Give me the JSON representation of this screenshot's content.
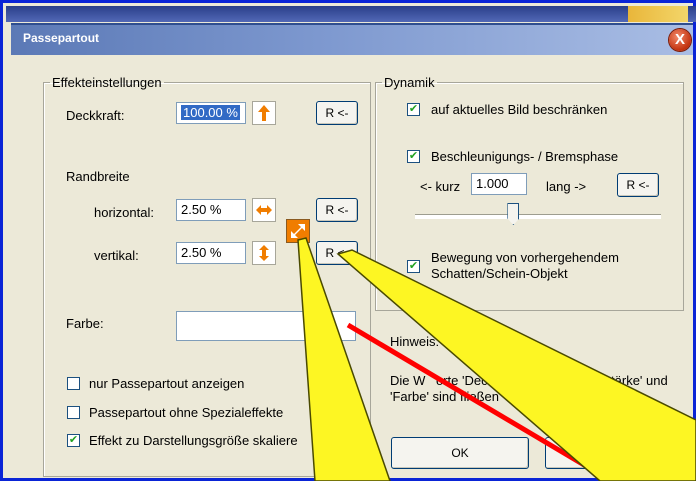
{
  "window": {
    "title": "Passepartout",
    "close_glyph": "X"
  },
  "effekt": {
    "legend": "Effekteinstellungen",
    "deckkraft_label": "Deckkraft:",
    "deckkraft_value": "100.00 %",
    "reset_label": "R <-",
    "randbreite_label": "Randbreite",
    "horizontal_label": "horizontal:",
    "horizontal_value": "2.50 %",
    "vertikal_label": "vertikal:",
    "vertikal_value": "2.50 %",
    "farbe_label": "Farbe:",
    "farbe_value": "",
    "checkboxes": [
      {
        "label": "nur Passepartout anzeigen",
        "checked": false
      },
      {
        "label": "Passepartout ohne Spezialeffekte",
        "checked": false
      },
      {
        "label": "Effekt zu Darstellungsgröße skaliere",
        "checked": true
      }
    ]
  },
  "dynamik": {
    "legend": "Dynamik",
    "cb_aktuelles": "auf aktuelles Bild beschränken",
    "cb_beschl": "Beschleunigungs- / Bremsphase",
    "kurz_label": "<- kurz",
    "kurz_value": "1.000",
    "lang_label": "lang ->",
    "reset_label": "R <-",
    "slider_level": 0.4,
    "cb_bewegung_line1": "Bewegung von vorhergehendem",
    "cb_bewegung_line2": "Schatten/Schein-Objekt"
  },
  "hinweis": {
    "label": "Hinweis:",
    "text_line1_a": "Die W",
    "text_line1_b": "orte 'Dec",
    "text_line1_c": "hmenstärke' und",
    "text_line2_a": "'Farbe' sind fließen",
    "text_line2_b": "d"
  },
  "buttons": {
    "ok": "OK"
  },
  "colors": {
    "accent_arrow": "#f07d00",
    "callout_fill": "#fdf623",
    "callout_stroke": "#4a4a00",
    "red_line": "#ff0000"
  }
}
